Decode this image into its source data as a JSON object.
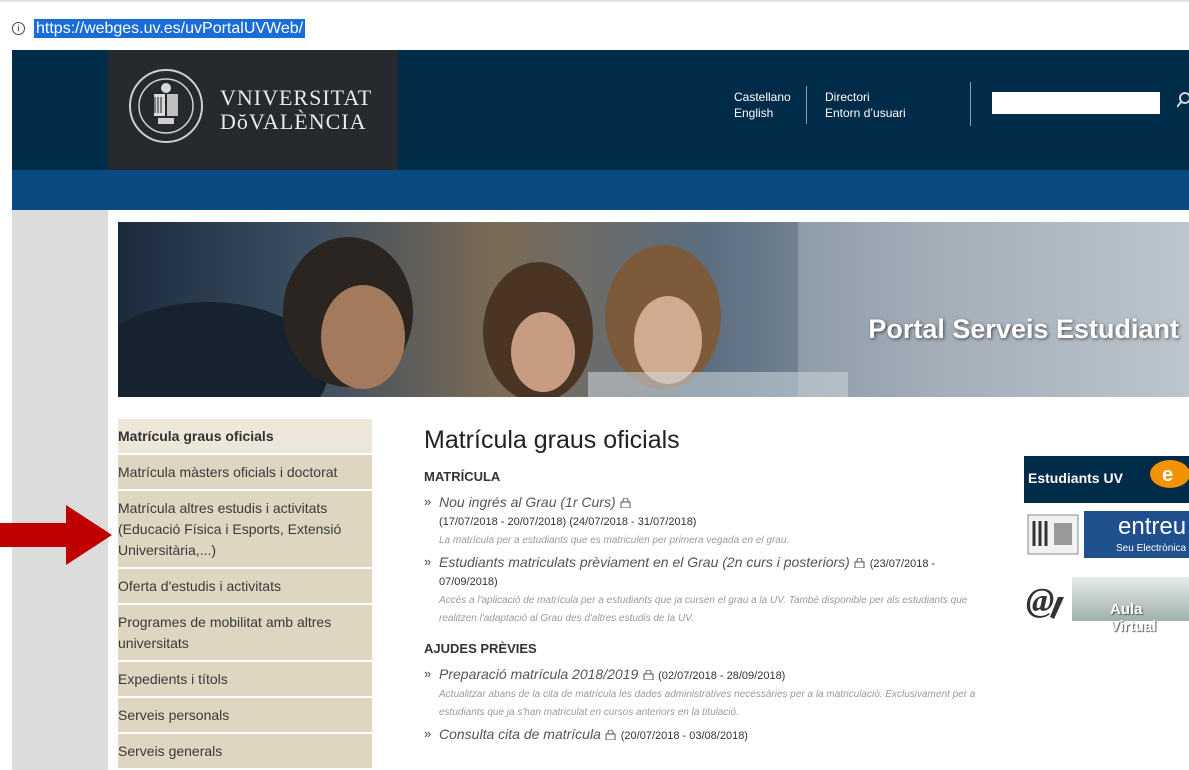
{
  "browser": {
    "url": "https://webges.uv.es/uvPortalUVWeb/"
  },
  "header": {
    "logo_line1": "VNIVERSITAT",
    "logo_line2": "DŏVALÈNCIA",
    "lang_1": "Castellano",
    "lang_2": "English",
    "link_1": "Directori",
    "link_2": "Entorn d’usuari",
    "search_value": ""
  },
  "banner": {
    "title": "Portal Serveis Estudiant"
  },
  "sidebar": {
    "items": [
      {
        "label": "Matrícula graus oficials"
      },
      {
        "label": "Matrícula màsters oficials i doctorat"
      },
      {
        "label": "Matrícula altres estudis i activitats (Educació Física i Esports, Extensió Universitària,...)"
      },
      {
        "label": "Oferta d'estudis i activitats"
      },
      {
        "label": "Programes de mobilitat amb altres universitats"
      },
      {
        "label": "Expedients i títols"
      },
      {
        "label": "Serveis personals"
      },
      {
        "label": "Serveis generals"
      }
    ]
  },
  "main": {
    "title": "Matrícula graus oficials",
    "section_1": "MATRÍCULA",
    "section_2": "AJUDES PRÈVIES",
    "bullet": "»",
    "items": [
      {
        "title": "Nou ingrés al Grau (1r Curs)",
        "dates": "(17/07/2018 - 20/07/2018) (24/07/2018 - 31/07/2018)",
        "desc": "La matrícula per a estudiants que es matriculen per primera vegada en el grau."
      },
      {
        "title": "Estudiants matriculats prèviament en el Grau (2n curs i posteriors)",
        "dates": "(23/07/2018 - 07/09/2018)",
        "desc": "Accés a l'aplicació de matrícula per a estudiants que ja cursen el grau a la UV. També disponible per als estudiants que realitzen l'adaptació al Grau des d'altres estudis de la UV."
      },
      {
        "title": "Preparació matrícula 2018/2019",
        "dates": "(02/07/2018 - 28/09/2018)",
        "desc": "Actualitzar abans de la cita de matrícula les dades administratives necessàries per a la matriculació. Exclusivament per a estudiants que ja s'han matriculat en cursos anteriors en la titulació."
      },
      {
        "title": "Consulta cita de matrícula",
        "dates": "(20/07/2018 - 03/08/2018)",
        "desc": ""
      }
    ]
  },
  "widgets": {
    "estudiants": "Estudiants UV",
    "entreu": "entreu",
    "entreu_sub": "Seu Electrònica",
    "aula": "Aula Virtual"
  },
  "colors": {
    "header": "#002b49",
    "bluebar": "#0a4a82",
    "nav_bg": "#ded6c1",
    "arrow": "#c00000"
  }
}
